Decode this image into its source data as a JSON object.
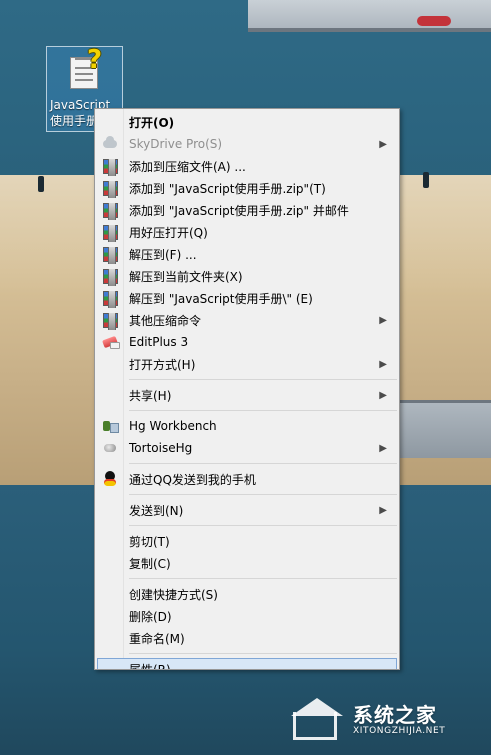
{
  "desktop": {
    "icon_label": "JavaScript使用手册"
  },
  "context_menu": {
    "items": [
      {
        "label": "打开(O)",
        "type": "item",
        "bold": true,
        "disabled": false,
        "submenu": false,
        "icon": ""
      },
      {
        "label": "SkyDrive Pro(S)",
        "type": "item",
        "bold": false,
        "disabled": true,
        "submenu": true,
        "icon": "cloud-icon"
      },
      {
        "label": "添加到压缩文件(A) ...",
        "type": "item",
        "bold": false,
        "disabled": false,
        "submenu": false,
        "icon": "winrar-icon"
      },
      {
        "label": "添加到 \"JavaScript使用手册.zip\"(T)",
        "type": "item",
        "bold": false,
        "disabled": false,
        "submenu": false,
        "icon": "winrar-icon"
      },
      {
        "label": "添加到 \"JavaScript使用手册.zip\" 并邮件",
        "type": "item",
        "bold": false,
        "disabled": false,
        "submenu": false,
        "icon": "winrar-icon"
      },
      {
        "label": "用好压打开(Q)",
        "type": "item",
        "bold": false,
        "disabled": false,
        "submenu": false,
        "icon": "winrar-icon"
      },
      {
        "label": "解压到(F) ...",
        "type": "item",
        "bold": false,
        "disabled": false,
        "submenu": false,
        "icon": "winrar-icon"
      },
      {
        "label": "解压到当前文件夹(X)",
        "type": "item",
        "bold": false,
        "disabled": false,
        "submenu": false,
        "icon": "winrar-icon"
      },
      {
        "label": "解压到 \"JavaScript使用手册\\\" (E)",
        "type": "item",
        "bold": false,
        "disabled": false,
        "submenu": false,
        "icon": "winrar-icon"
      },
      {
        "label": "其他压缩命令",
        "type": "item",
        "bold": false,
        "disabled": false,
        "submenu": true,
        "icon": "winrar-icon"
      },
      {
        "label": "EditPlus 3",
        "type": "item",
        "bold": false,
        "disabled": false,
        "submenu": false,
        "icon": "editplus-icon"
      },
      {
        "label": "打开方式(H)",
        "type": "item",
        "bold": false,
        "disabled": false,
        "submenu": true,
        "icon": ""
      },
      {
        "type": "separator"
      },
      {
        "label": "共享(H)",
        "type": "item",
        "bold": false,
        "disabled": false,
        "submenu": true,
        "icon": ""
      },
      {
        "type": "separator"
      },
      {
        "label": "Hg Workbench",
        "type": "item",
        "bold": false,
        "disabled": false,
        "submenu": false,
        "icon": "hg-workbench-icon"
      },
      {
        "label": "TortoiseHg",
        "type": "item",
        "bold": false,
        "disabled": false,
        "submenu": true,
        "icon": "tortoisehg-icon"
      },
      {
        "type": "separator"
      },
      {
        "label": "通过QQ发送到我的手机",
        "type": "item",
        "bold": false,
        "disabled": false,
        "submenu": false,
        "icon": "qq-icon"
      },
      {
        "type": "separator"
      },
      {
        "label": "发送到(N)",
        "type": "item",
        "bold": false,
        "disabled": false,
        "submenu": true,
        "icon": ""
      },
      {
        "type": "separator"
      },
      {
        "label": "剪切(T)",
        "type": "item",
        "bold": false,
        "disabled": false,
        "submenu": false,
        "icon": ""
      },
      {
        "label": "复制(C)",
        "type": "item",
        "bold": false,
        "disabled": false,
        "submenu": false,
        "icon": ""
      },
      {
        "type": "separator"
      },
      {
        "label": "创建快捷方式(S)",
        "type": "item",
        "bold": false,
        "disabled": false,
        "submenu": false,
        "icon": ""
      },
      {
        "label": "删除(D)",
        "type": "item",
        "bold": false,
        "disabled": false,
        "submenu": false,
        "icon": ""
      },
      {
        "label": "重命名(M)",
        "type": "item",
        "bold": false,
        "disabled": false,
        "submenu": false,
        "icon": ""
      },
      {
        "type": "separator"
      },
      {
        "label": "属性(R)",
        "type": "item",
        "bold": false,
        "disabled": false,
        "submenu": false,
        "icon": "",
        "selected": true
      }
    ]
  },
  "watermark": {
    "title": "系统之家",
    "subtitle": "XITONGZHIJIA.NET"
  }
}
